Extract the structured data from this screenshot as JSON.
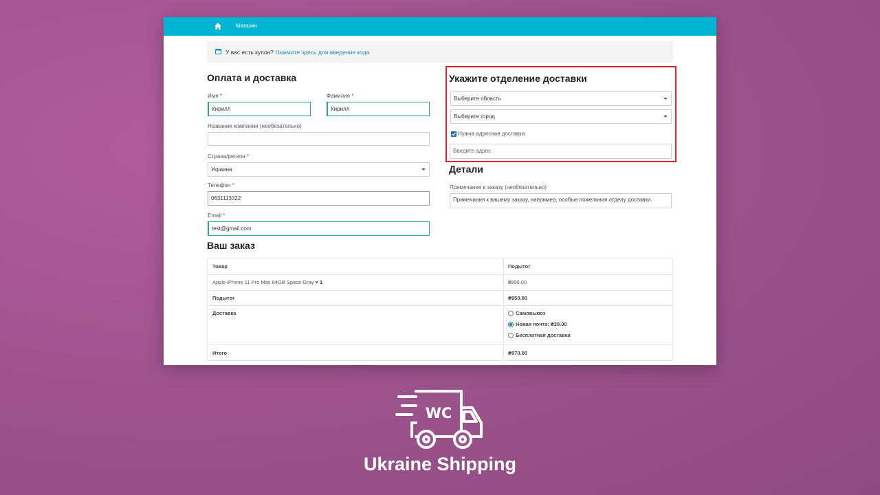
{
  "nav": {
    "shop": "Магазин"
  },
  "coupon": {
    "text": "У вас есть купон?",
    "link": "Нажмите здесь для введения кода"
  },
  "billing": {
    "title": "Оплата и доставка",
    "first_name_label": "Имя",
    "first_name_value": "Кирилл",
    "last_name_label": "Фамилия",
    "last_name_value": "Кирилл",
    "company_label": "Название компании (необязательно)",
    "company_value": "",
    "country_label": "Страна/регион",
    "country_value": "Украина",
    "phone_label": "Телефон",
    "phone_value": "0631113322",
    "email_label": "Email",
    "email_value": "test@gmail.com",
    "required_mark": "*"
  },
  "delivery": {
    "title": "Укажите отделение доставки",
    "region_placeholder": "Выберите область",
    "city_placeholder": "Выберите город",
    "address_delivery_label": "Нужна адресная доставка",
    "address_delivery_checked": true,
    "address_placeholder": "Введите адрес"
  },
  "details": {
    "title": "Детали",
    "notes_label": "Примечание к заказу (необязательно)",
    "notes_placeholder": "Примечания к вашему заказу, например, особые пожелания отделу доставки."
  },
  "order": {
    "title": "Ваш заказ",
    "col_product": "Товар",
    "col_subtotal": "Подытог",
    "item_name": "Apple iPhone 11 Pro Max 64GB Space Gray",
    "item_qty": "× 1",
    "item_price": "₴950.00",
    "subtotal_label": "Подытог",
    "subtotal_value": "₴950.00",
    "shipping_label": "Доставка",
    "shipping_options": [
      {
        "label": "Самовывоз",
        "selected": false
      },
      {
        "label": "Новая почта: ₴20.00",
        "selected": true
      },
      {
        "label": "Бесплатная доставка",
        "selected": false
      }
    ],
    "total_label": "Итого",
    "total_value": "₴970.00"
  },
  "brand": {
    "logo_text": "WC",
    "name": "Ukraine Shipping"
  },
  "colors": {
    "topbar": "#00b5d4",
    "background": "#a0548e",
    "highlight": "#e21f2b",
    "link": "#1d8fb8"
  }
}
